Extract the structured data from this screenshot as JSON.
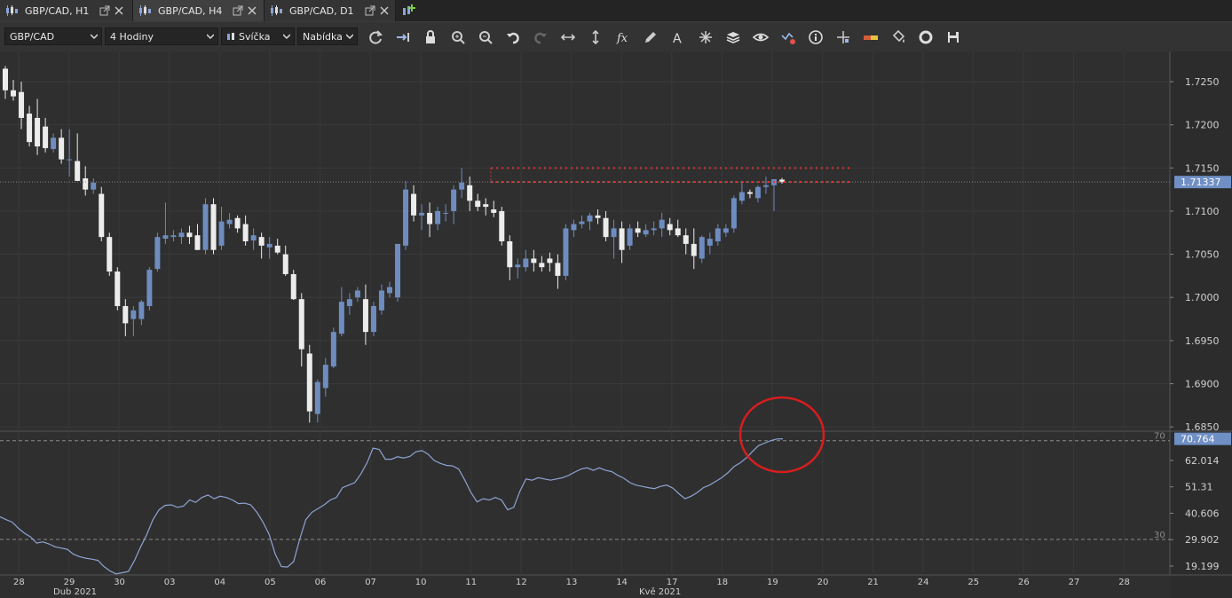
{
  "tabs": [
    {
      "label": "GBP/CAD, H1",
      "active": false
    },
    {
      "label": "GBP/CAD, H4",
      "active": true
    },
    {
      "label": "GBP/CAD, D1",
      "active": false
    }
  ],
  "toolbar": {
    "symbol": "GBP/CAD",
    "timeframe": "4 Hodiny",
    "chart_type": "Svíčka",
    "price_type": "Nabídka",
    "icons": [
      "refresh-icon",
      "auto-scroll-icon",
      "lock-icon",
      "zoom-in-icon",
      "zoom-out-icon",
      "undo-icon",
      "redo-icon",
      "horizontal-arrows-icon",
      "vertical-arrows-icon",
      "indicators-fx-icon",
      "pencil-icon",
      "text-icon",
      "crosshair-star-icon",
      "layers-icon",
      "eye-icon",
      "chart-alert-icon",
      "info-icon",
      "cursor-cross-icon",
      "color-bar-icon",
      "paint-bucket-icon",
      "settings-ring-icon",
      "save-icon"
    ]
  },
  "colors": {
    "background": "#2f2f2f",
    "bull_candle": "#6e8cbf",
    "bear_candle": "#ececec",
    "resistance": "#e03030",
    "price_label": "#6f8fc5",
    "rsi_line": "#8fa3d3",
    "circle": "#d61e1e"
  },
  "chart_data": [
    {
      "type": "candlestick",
      "y_ticks": [
        "1.7250",
        "1.7200",
        "1.7150",
        "1.7100",
        "1.7050",
        "1.7000",
        "1.6950",
        "1.6900",
        "1.6850"
      ],
      "ylim": [
        1.6845,
        1.7285
      ],
      "current_price": "1.71337",
      "current_price_value": 1.71337,
      "resistance_levels": [
        1.715,
        1.71337
      ],
      "candles": [
        [
          1.7265,
          1.7268,
          1.723,
          1.724
        ],
        [
          1.724,
          1.7252,
          1.7228,
          1.7233
        ],
        [
          1.7238,
          1.725,
          1.7195,
          1.7208
        ],
        [
          1.7213,
          1.7222,
          1.7175,
          1.718
        ],
        [
          1.7208,
          1.723,
          1.7165,
          1.7175
        ],
        [
          1.7198,
          1.7208,
          1.7168,
          1.7173
        ],
        [
          1.7172,
          1.719,
          1.7168,
          1.7185
        ],
        [
          1.7185,
          1.7195,
          1.7155,
          1.716
        ],
        [
          1.716,
          1.7195,
          1.714,
          1.716
        ],
        [
          1.7158,
          1.719,
          1.7135,
          1.7135
        ],
        [
          1.7138,
          1.7152,
          1.7118,
          1.7125
        ],
        [
          1.7125,
          1.7138,
          1.712,
          1.7133
        ],
        [
          1.712,
          1.7128,
          1.7065,
          1.707
        ],
        [
          1.707,
          1.7075,
          1.7025,
          1.703
        ],
        [
          1.703,
          1.7035,
          1.6985,
          1.699
        ],
        [
          1.699,
          1.6998,
          1.6955,
          1.697
        ],
        [
          1.6975,
          1.699,
          1.6955,
          1.6985
        ],
        [
          1.6975,
          1.6997,
          1.6968,
          1.6995
        ],
        [
          1.699,
          1.7035,
          1.6985,
          1.7032
        ],
        [
          1.7033,
          1.7075,
          1.703,
          1.707
        ],
        [
          1.7068,
          1.711,
          1.7062,
          1.7072
        ],
        [
          1.707,
          1.7078,
          1.7065,
          1.7072
        ],
        [
          1.707,
          1.708,
          1.7062,
          1.7075
        ],
        [
          1.7075,
          1.7083,
          1.7062,
          1.707
        ],
        [
          1.7072,
          1.7085,
          1.7055,
          1.7055
        ],
        [
          1.7055,
          1.7115,
          1.705,
          1.7108
        ],
        [
          1.7108,
          1.7115,
          1.705,
          1.7055
        ],
        [
          1.706,
          1.7105,
          1.7055,
          1.7088
        ],
        [
          1.7085,
          1.7098,
          1.708,
          1.709
        ],
        [
          1.7092,
          1.7095,
          1.7075,
          1.708
        ],
        [
          1.7085,
          1.7095,
          1.706,
          1.7065
        ],
        [
          1.7066,
          1.708,
          1.7055,
          1.7072
        ],
        [
          1.707,
          1.7075,
          1.7045,
          1.706
        ],
        [
          1.7058,
          1.707,
          1.7045,
          1.7062
        ],
        [
          1.706,
          1.7068,
          1.705,
          1.7052
        ],
        [
          1.705,
          1.706,
          1.7025,
          1.7027
        ],
        [
          1.7027,
          1.7032,
          1.6997,
          1.6998
        ],
        [
          1.6998,
          1.7005,
          1.692,
          1.694
        ],
        [
          1.6935,
          1.6945,
          1.6855,
          1.6868
        ],
        [
          1.6865,
          1.6905,
          1.6855,
          1.6902
        ],
        [
          1.6895,
          1.693,
          1.6885,
          1.6922
        ],
        [
          1.692,
          1.6965,
          1.6918,
          1.696
        ],
        [
          1.6958,
          1.7012,
          1.6955,
          1.6995
        ],
        [
          1.699,
          1.7005,
          1.698,
          1.6998
        ],
        [
          1.7,
          1.7012,
          1.6995,
          1.7008
        ],
        [
          1.6998,
          1.7015,
          1.6945,
          1.696
        ],
        [
          1.696,
          1.6995,
          1.6955,
          1.699
        ],
        [
          1.6985,
          1.7015,
          1.698,
          1.7008
        ],
        [
          1.7005,
          1.7018,
          1.7,
          1.7012
        ],
        [
          1.7,
          1.7062,
          1.6995,
          1.7062
        ],
        [
          1.706,
          1.7135,
          1.7055,
          1.7125
        ],
        [
          1.712,
          1.713,
          1.7088,
          1.7095
        ],
        [
          1.7095,
          1.7108,
          1.7078,
          1.7098
        ],
        [
          1.7098,
          1.711,
          1.707,
          1.7085
        ],
        [
          1.7085,
          1.7105,
          1.7078,
          1.71
        ],
        [
          1.7097,
          1.7108,
          1.7088,
          1.7098
        ],
        [
          1.71,
          1.713,
          1.7085,
          1.7125
        ],
        [
          1.7125,
          1.715,
          1.7115,
          1.7133
        ],
        [
          1.713,
          1.714,
          1.71,
          1.7112
        ],
        [
          1.7112,
          1.712,
          1.71,
          1.7105
        ],
        [
          1.7108,
          1.7115,
          1.7095,
          1.7105
        ],
        [
          1.7102,
          1.7112,
          1.7093,
          1.7098
        ],
        [
          1.71,
          1.7105,
          1.706,
          1.7065
        ],
        [
          1.7065,
          1.7072,
          1.702,
          1.7035
        ],
        [
          1.7035,
          1.7045,
          1.7022,
          1.7038
        ],
        [
          1.7035,
          1.7055,
          1.703,
          1.7045
        ],
        [
          1.7045,
          1.7055,
          1.703,
          1.704
        ],
        [
          1.704,
          1.7048,
          1.703,
          1.7035
        ],
        [
          1.7045,
          1.7052,
          1.703,
          1.704
        ],
        [
          1.704,
          1.705,
          1.701,
          1.7025
        ],
        [
          1.7025,
          1.7085,
          1.702,
          1.708
        ],
        [
          1.7078,
          1.709,
          1.707,
          1.7085
        ],
        [
          1.7085,
          1.7095,
          1.708,
          1.7088
        ],
        [
          1.7088,
          1.7098,
          1.7078,
          1.7095
        ],
        [
          1.7095,
          1.7102,
          1.7085,
          1.7092
        ],
        [
          1.7092,
          1.71,
          1.7065,
          1.707
        ],
        [
          1.707,
          1.709,
          1.7045,
          1.708
        ],
        [
          1.708,
          1.7088,
          1.704,
          1.7055
        ],
        [
          1.706,
          1.7085,
          1.7055,
          1.708
        ],
        [
          1.708,
          1.7088,
          1.707,
          1.7075
        ],
        [
          1.7073,
          1.7085,
          1.707,
          1.7078
        ],
        [
          1.7078,
          1.7088,
          1.7072,
          1.708
        ],
        [
          1.708,
          1.7098,
          1.707,
          1.709
        ],
        [
          1.7085,
          1.7092,
          1.7072,
          1.7078
        ],
        [
          1.708,
          1.709,
          1.707,
          1.7072
        ],
        [
          1.7072,
          1.708,
          1.705,
          1.7062
        ],
        [
          1.7062,
          1.708,
          1.7033,
          1.7048
        ],
        [
          1.7045,
          1.7072,
          1.704,
          1.707
        ],
        [
          1.706,
          1.7075,
          1.705,
          1.7068
        ],
        [
          1.7065,
          1.7085,
          1.706,
          1.708
        ],
        [
          1.7075,
          1.7085,
          1.707,
          1.708
        ],
        [
          1.708,
          1.7118,
          1.7075,
          1.7115
        ],
        [
          1.7112,
          1.7135,
          1.7108,
          1.7122
        ],
        [
          1.7122,
          1.7125,
          1.7115,
          1.712
        ],
        [
          1.7115,
          1.713,
          1.711,
          1.7128
        ],
        [
          1.7128,
          1.714,
          1.712,
          1.713
        ],
        [
          1.713,
          1.7137,
          1.71,
          1.7137
        ],
        [
          1.71365,
          1.71385,
          1.7132,
          1.71337
        ]
      ],
      "price_chart_x_ticks": [
        "28",
        "29",
        "30",
        "03",
        "04",
        "05",
        "06",
        "07",
        "10",
        "11",
        "12",
        "13",
        "14",
        "17",
        "18",
        "19",
        "20",
        "21",
        "24",
        "25",
        "26",
        "27",
        "28"
      ],
      "date_labels": [
        "Dub 2021",
        "Kvě 2021"
      ]
    },
    {
      "type": "line",
      "series": [
        {
          "values": [
            39.2,
            38,
            37,
            34.5,
            32.5,
            31,
            28.5,
            29,
            28.2,
            27,
            26.5,
            26,
            24,
            23,
            22.4,
            22,
            21.5,
            19,
            17.2,
            16,
            16.5,
            17,
            21.5,
            27,
            32,
            38,
            42,
            43.8,
            44,
            43,
            43.5,
            46,
            45,
            47,
            48,
            46.5,
            47.5,
            47,
            46,
            44.5,
            44.7,
            44,
            41,
            37,
            32,
            24,
            19,
            18.8,
            21,
            30,
            38,
            41,
            42.5,
            44,
            46,
            47,
            51,
            52,
            53,
            56.5,
            61,
            67,
            66.5,
            62.5,
            62.5,
            63.5,
            63,
            63.6,
            65.5,
            66,
            64.5,
            62,
            60.8,
            60,
            59.8,
            58.5,
            54,
            49,
            45.2,
            46.5,
            46,
            47,
            46,
            42,
            43,
            49.5,
            54.5,
            54,
            55,
            54.5,
            54,
            54.5,
            55,
            56,
            57.3,
            58.5,
            59,
            58,
            59,
            58,
            57.5,
            56,
            54.8,
            53,
            52,
            51.5,
            51,
            50.6,
            51.5,
            52,
            50.8,
            48.5,
            46.5,
            47.5,
            49,
            51,
            52,
            53.5,
            55,
            57,
            59.5,
            61,
            63,
            65.5,
            68,
            69,
            70,
            70.7,
            70.764
          ]
        }
      ],
      "y_ticks": [
        "62.014",
        "51.31",
        "40.606",
        "29.902",
        "19.199"
      ],
      "ylim": [
        15.6,
        73.5
      ],
      "levels": [
        {
          "label": "70",
          "value": 70
        },
        {
          "label": "30",
          "value": 30
        }
      ],
      "current_value": "70.764"
    }
  ]
}
